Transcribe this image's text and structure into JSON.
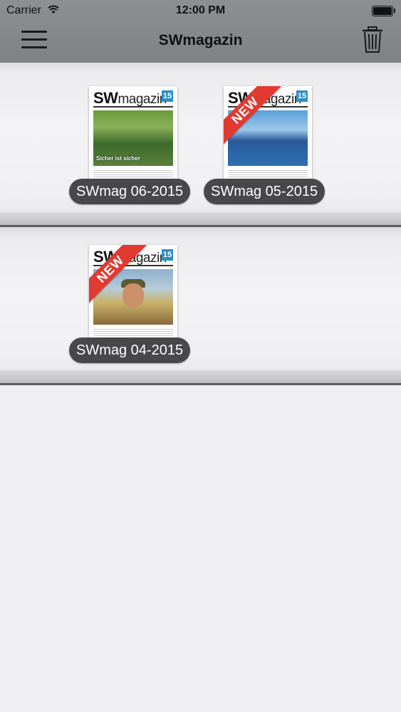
{
  "status_bar": {
    "carrier": "Carrier",
    "time": "12:00 PM"
  },
  "nav": {
    "title": "SWmagazin",
    "menu_icon": "hamburger-icon",
    "trash_icon": "trash-icon"
  },
  "issues": [
    {
      "label": "SWmag 06-2015",
      "is_new": false,
      "cover": {
        "mast_sw": "SW",
        "mast_rest": "magazin",
        "number": "15",
        "headline": "Sicher ist sicher"
      }
    },
    {
      "label": "SWmag 05-2015",
      "is_new": true,
      "ribbon": "NEW",
      "cover": {
        "mast_sw": "SW",
        "mast_rest": "magazin",
        "number": "15"
      }
    },
    {
      "label": "SWmag 04-2015",
      "is_new": true,
      "ribbon": "NEW",
      "cover": {
        "mast_sw": "SW",
        "mast_rest": "magazin",
        "number": "15"
      }
    }
  ],
  "colors": {
    "nav_bg": "#838587",
    "ribbon": "#e23a30",
    "pill": "#3a3a3c",
    "accent": "#2f8ec4"
  }
}
